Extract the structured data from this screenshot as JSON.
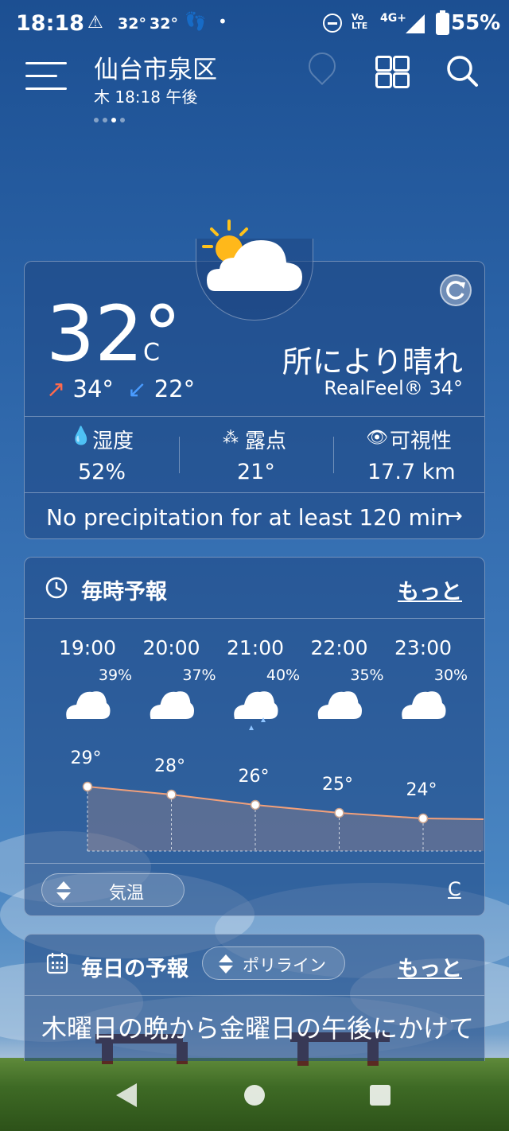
{
  "status_bar": {
    "time": "18:18",
    "temp1": "32°",
    "temp2": "32°",
    "network": "4G+",
    "volte": "Vo LTE",
    "battery": "55%"
  },
  "header": {
    "location": "仙台市泉区",
    "datetime": "木 18:18 午後",
    "pager_dots": 4,
    "active_dot": 2
  },
  "current": {
    "temperature": "32°",
    "unit": "C",
    "high": "34°",
    "low": "22°",
    "condition": "所により晴れ",
    "realfeel": "RealFeel® 34°",
    "humidity_label": "湿度",
    "humidity_value": "52%",
    "dewpoint_label": "露点",
    "dewpoint_value": "21°",
    "visibility_label": "可視性",
    "visibility_value": "17.7 km",
    "precip_message": "No precipitation for at least 120 min",
    "arrow": "→"
  },
  "hourly": {
    "title": "毎時予報",
    "more": "もっと",
    "hours": [
      {
        "time": "19:00",
        "precip": "39%",
        "temp": "29°",
        "icon": "cloud-icon"
      },
      {
        "time": "20:00",
        "precip": "37%",
        "temp": "28°",
        "icon": "cloud-icon"
      },
      {
        "time": "21:00",
        "precip": "40%",
        "temp": "26°",
        "icon": "cloud-rain-icon"
      },
      {
        "time": "22:00",
        "precip": "35%",
        "temp": "25°",
        "icon": "cloud-icon"
      },
      {
        "time": "23:00",
        "precip": "30%",
        "temp": "24°",
        "icon": "cloud-icon"
      }
    ],
    "chart_mode": "気温",
    "unit_toggle": "C"
  },
  "daily": {
    "title": "毎日の予報",
    "mode": "ポリライン",
    "more": "もっと",
    "summary": "木曜日の晩から金曜日の午後にかけて"
  },
  "colors": {
    "card_bg": "#1e4682",
    "line": "#f2a07a",
    "high_arrow": "#ff6a4d",
    "low_arrow": "#4a9cff"
  }
}
